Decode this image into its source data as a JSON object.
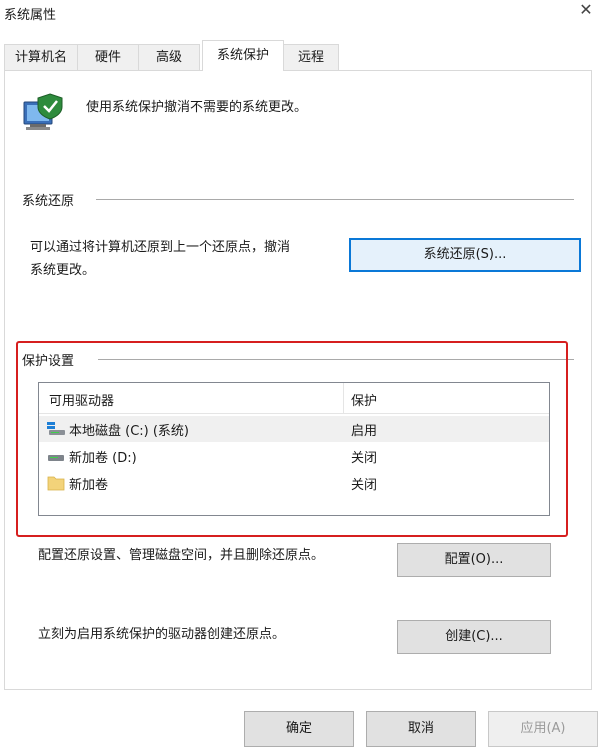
{
  "window": {
    "title": "系统属性"
  },
  "tabs": [
    {
      "label": "计算机名"
    },
    {
      "label": "硬件"
    },
    {
      "label": "高级"
    },
    {
      "label": "系统保护"
    },
    {
      "label": "远程"
    }
  ],
  "intro": {
    "text": "使用系统保护撤消不需要的系统更改。"
  },
  "restore": {
    "section_title": "系统还原",
    "description_line1": "可以通过将计算机还原到上一个还原点，撤消",
    "description_line2": "系统更改。",
    "button_label": "系统还原(S)..."
  },
  "protection": {
    "section_title": "保护设置",
    "columns": {
      "drive": "可用驱动器",
      "protection": "保护"
    },
    "drives": [
      {
        "name": "本地磁盘 (C:) (系统)",
        "protection": "启用",
        "icon": "system-drive-icon"
      },
      {
        "name": "新加卷 (D:)",
        "protection": "关闭",
        "icon": "drive-icon"
      },
      {
        "name": "新加卷",
        "protection": "关闭",
        "icon": "folder-icon"
      }
    ],
    "configure_text": "配置还原设置、管理磁盘空间，并且删除还原点。",
    "configure_button": "配置(O)...",
    "create_text": "立刻为启用系统保护的驱动器创建还原点。",
    "create_button": "创建(C)..."
  },
  "footer": {
    "ok": "确定",
    "cancel": "取消",
    "apply": "应用(A)"
  },
  "colors": {
    "highlight_border": "#d61f1f",
    "focus_border": "#0a78d7"
  }
}
